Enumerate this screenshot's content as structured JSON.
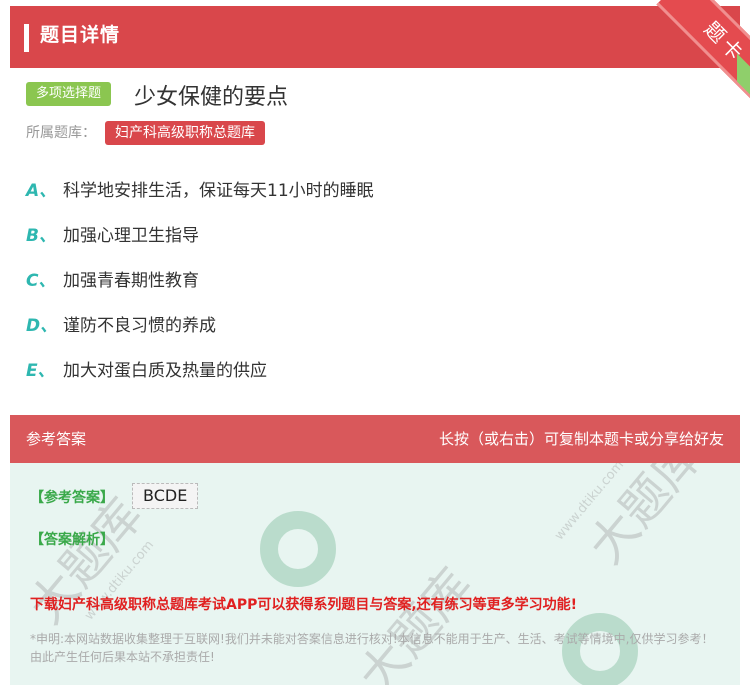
{
  "header": {
    "title": "题目详情",
    "ribbon_label": "题卡"
  },
  "question": {
    "type_badge": "多项选择题",
    "title": "少女保健的要点",
    "bank_label": "所属题库：",
    "bank_name": "妇产科高级职称总题库"
  },
  "options": [
    {
      "letter": "A、",
      "text": "科学地安排生活，保证每天11小时的睡眠"
    },
    {
      "letter": "B、",
      "text": "加强心理卫生指导"
    },
    {
      "letter": "C、",
      "text": "加强青春期性教育"
    },
    {
      "letter": "D、",
      "text": "谨防不良习惯的养成"
    },
    {
      "letter": "E、",
      "text": "加大对蛋白质及热量的供应"
    }
  ],
  "answer_section": {
    "title": "参考答案",
    "share_hint": "长按（或右击）可复制本题卡或分享给好友",
    "answer_label": "【参考答案】",
    "answer_value": "BCDE",
    "explanation_label": "【答案解析】",
    "promo": "下载妇产科高级职称总题库考试APP可以获得系列题目与答案,还有练习等更多学习功能!",
    "disclaimer": "*申明:本网站数据收集整理于互联网!我们并未能对答案信息进行核对!本信息不能用于生产、生活、考试等情境中,仅供学习参考！由此产生任何后果本站不承担责任!"
  },
  "colors": {
    "accent_red": "#d9474b",
    "option_letter": "#2eb7b0",
    "tag_green": "#8bc650",
    "answer_green": "#3aa94a",
    "promo_red": "#e02020"
  }
}
